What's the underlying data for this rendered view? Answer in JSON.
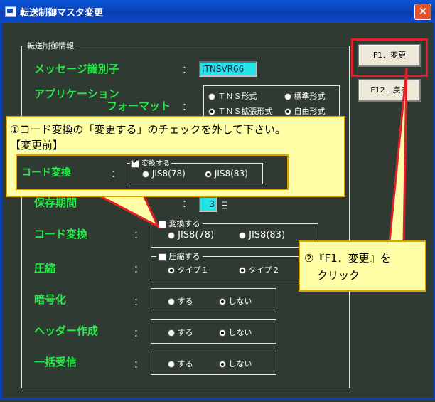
{
  "window": {
    "title": "転送制御マスタ変更",
    "close_glyph": "✕"
  },
  "group": {
    "label": "転送制御情報"
  },
  "fields": {
    "message_id": {
      "label": "メッセージ識別子",
      "value": "ITNSVR66"
    },
    "app_format": {
      "label_line1": "アプリケーション",
      "label_line2": "フォーマット",
      "options": [
        "ＴＮＳ形式",
        "標準形式",
        "ＴＮＳ拡張形式",
        "自由形式"
      ]
    },
    "retention": {
      "label": "保存期間",
      "value": "3",
      "unit": "日"
    },
    "code_conversion": {
      "label": "コード変換",
      "checkbox_label": "変換する",
      "checked": false,
      "options": [
        "JIS8(78)",
        "JIS8(83)"
      ]
    },
    "compression": {
      "label": "圧縮",
      "checkbox_label": "圧縮する",
      "checked": false,
      "options": [
        "タイプ１",
        "タイプ２"
      ]
    },
    "encryption": {
      "label": "暗号化",
      "options": [
        "する",
        "しない"
      ],
      "selected": "しない"
    },
    "header_creation": {
      "label": "ヘッダー作成",
      "options": [
        "する",
        "しない"
      ],
      "selected": "しない"
    },
    "bulk_receive": {
      "label": "一括受信",
      "options": [
        "する",
        "しない"
      ],
      "selected": "しない"
    }
  },
  "colon": "：",
  "buttons": {
    "f1_change": "F1．変更",
    "f12_back": "F12．戻る"
  },
  "callout1": {
    "line1": "①コード変換の「変更する」のチェックを外して下さい。",
    "line2": "【変更前】",
    "inner_label": "コード変換",
    "inner_checkbox_label": "変換する",
    "inner_options": [
      "JIS8(78)",
      "JIS8(83)"
    ],
    "inner_selected": "JIS8(83)"
  },
  "callout2": {
    "line1": "②『F1．変更』を",
    "line2": "クリック"
  },
  "colors": {
    "label_green": "#29e84a",
    "field_cyan": "#22e5ea",
    "callout_bg": "#ffffa8",
    "highlight_red": "#e0202a"
  }
}
